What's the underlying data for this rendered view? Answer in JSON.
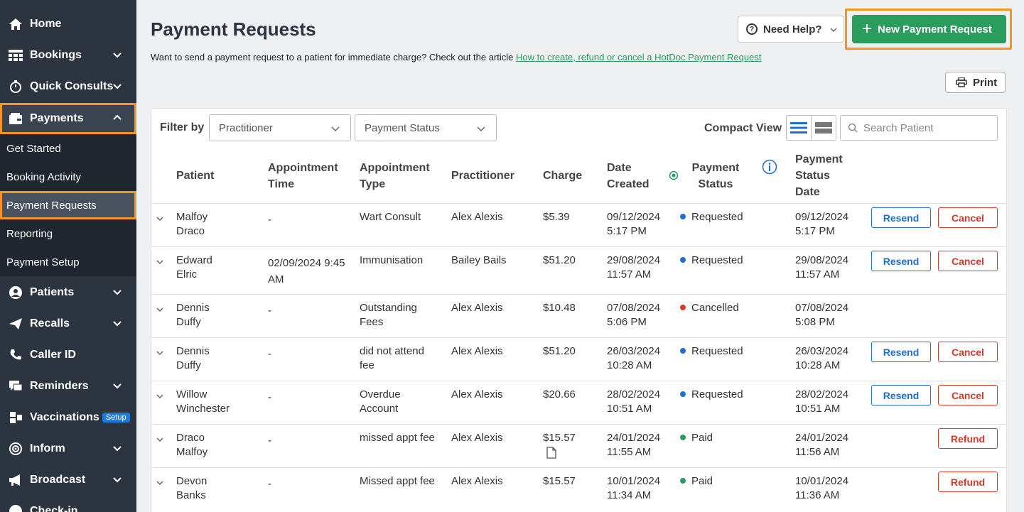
{
  "sidebar": {
    "items": [
      {
        "label": "Home",
        "icon": "home-icon"
      },
      {
        "label": "Bookings",
        "icon": "calendar-grid-icon"
      },
      {
        "label": "Quick Consults",
        "icon": "stopwatch-icon"
      },
      {
        "label": "Payments",
        "icon": "wallet-icon"
      },
      {
        "label": "Patients",
        "icon": "user-circle-icon"
      },
      {
        "label": "Recalls",
        "icon": "paper-plane-icon"
      },
      {
        "label": "Caller ID",
        "icon": "phone-icon"
      },
      {
        "label": "Reminders",
        "icon": "chat-icon"
      },
      {
        "label": "Vaccinations",
        "icon": "syringe-icon",
        "badge": "Setup"
      },
      {
        "label": "Inform",
        "icon": "target-icon"
      },
      {
        "label": "Broadcast",
        "icon": "megaphone-icon"
      },
      {
        "label": "Check-in",
        "icon": "check-icon"
      }
    ],
    "payments_sub": [
      "Get Started",
      "Booking Activity",
      "Payment Requests",
      "Reporting",
      "Payment Setup"
    ]
  },
  "header": {
    "title": "Payment Requests",
    "intro": "Want to send a payment request to a patient for immediate charge? Check out the article ",
    "intro_link": "How to create, refund or cancel a HotDoc Payment Request",
    "help_label": "Need Help?",
    "new_label": "New Payment Request",
    "print_label": "Print"
  },
  "filters": {
    "label": "Filter by",
    "practitioner": "Practitioner",
    "status": "Payment Status",
    "compact_label": "Compact View",
    "search_placeholder": "Search Patient"
  },
  "table": {
    "headers": {
      "patient": "Patient",
      "appt_time": "Appointment Time",
      "appt_type": "Appointment Type",
      "practitioner": "Practitioner",
      "charge": "Charge",
      "date_created": "Date Created",
      "payment_status": "Payment Status",
      "status_date": "Payment Status Date"
    },
    "rows": [
      {
        "patient": "Malfoy Draco",
        "time": "-",
        "type": "Wart Consult",
        "practitioner": "Alex Alexis",
        "charge": "$5.39",
        "created": "09/12/2024 5:17 PM",
        "status": "Requested",
        "status_date": "09/12/2024 5:17 PM",
        "actions": [
          "Resend",
          "Cancel"
        ]
      },
      {
        "patient": "Edward Elric",
        "time": "02/09/2024 9:45 AM",
        "type": "Immunisation",
        "practitioner": "Bailey Bails",
        "charge": "$51.20",
        "created": "29/08/2024 11:57 AM",
        "status": "Requested",
        "status_date": "29/08/2024 11:57 AM",
        "actions": [
          "Resend",
          "Cancel"
        ]
      },
      {
        "patient": "Dennis Duffy",
        "time": "-",
        "type": "Outstanding Fees",
        "practitioner": "Alex Alexis",
        "charge": "$10.48",
        "created": "07/08/2024 5:06 PM",
        "status": "Cancelled",
        "status_date": "07/08/2024 5:08 PM",
        "actions": []
      },
      {
        "patient": "Dennis Duffy",
        "time": "-",
        "type": "did not attend fee",
        "practitioner": "Alex Alexis",
        "charge": "$51.20",
        "created": "26/03/2024 10:28 AM",
        "status": "Requested",
        "status_date": "26/03/2024 10:28 AM",
        "actions": [
          "Resend",
          "Cancel"
        ]
      },
      {
        "patient": "Willow Winchester",
        "time": "-",
        "type": "Overdue Account",
        "practitioner": "Alex Alexis",
        "charge": "$20.66",
        "created": "28/02/2024 10:51 AM",
        "status": "Requested",
        "status_date": "28/02/2024 10:51 AM",
        "actions": [
          "Resend",
          "Cancel"
        ]
      },
      {
        "patient": "Draco Malfoy",
        "time": "-",
        "type": "missed appt fee",
        "practitioner": "Alex Alexis",
        "charge": "$15.57",
        "created": "24/01/2024 11:55 AM",
        "status": "Paid",
        "status_date": "24/01/2024 11:56 AM",
        "actions": [
          "Refund"
        ]
      },
      {
        "patient": "Devon Banks",
        "time": "-",
        "type": "Missed appt fee",
        "practitioner": "Alex Alexis",
        "charge": "$15.57",
        "created": "10/01/2024 11:34 AM",
        "status": "Paid",
        "status_date": "10/01/2024 11:36 AM",
        "actions": [
          "Refund"
        ]
      }
    ]
  },
  "colors": {
    "accent_green": "#2a9d5c",
    "highlight_orange": "#f5941e",
    "requested": "#1f6fd0",
    "cancelled": "#d23c2a",
    "paid": "#2a9d5c"
  }
}
